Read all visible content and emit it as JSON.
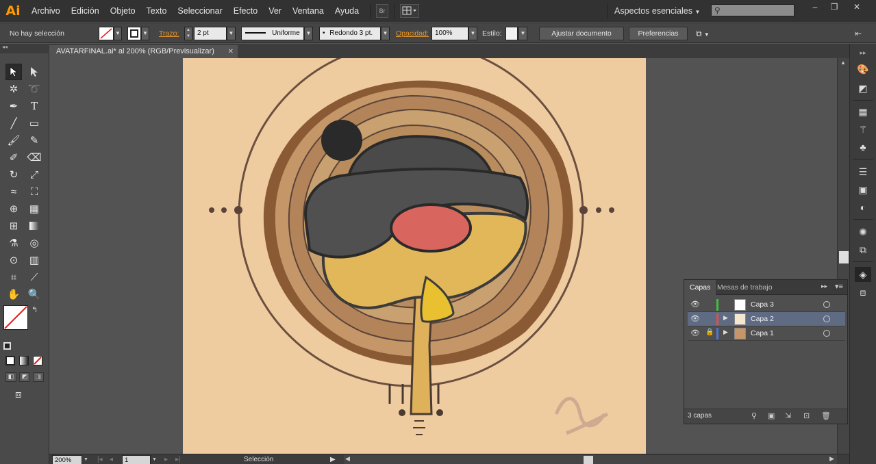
{
  "app": {
    "logo": "Ai"
  },
  "menu": [
    "Archivo",
    "Edición",
    "Objeto",
    "Texto",
    "Seleccionar",
    "Efecto",
    "Ver",
    "Ventana",
    "Ayuda"
  ],
  "menubar": {
    "bridge_label": "Br",
    "workspace": "Aspectos esenciales"
  },
  "control": {
    "selection": "No hay selección",
    "stroke_label": "Trazo:",
    "stroke_value": "2 pt",
    "profile": "Uniforme",
    "brush": "Redondo 3 pt.",
    "opacity_label": "Opacidad:",
    "opacity_value": "100%",
    "style_label": "Estilo:",
    "adjust_button": "Ajustar documento",
    "prefs_button": "Preferencias"
  },
  "document": {
    "tab_title": "AVATARFINAL.ai* al 200% (RGB/Previsualizar)"
  },
  "layers_panel": {
    "tabs": [
      "Capas",
      "Mesas de trabajo"
    ],
    "layers": [
      {
        "name": "Capa 3",
        "color": "#3fc13f",
        "locked": false,
        "selected": false,
        "expandable": false
      },
      {
        "name": "Capa 2",
        "color": "#d9534f",
        "locked": false,
        "selected": true,
        "expandable": true
      },
      {
        "name": "Capa 1",
        "color": "#4a78d6",
        "locked": true,
        "selected": false,
        "expandable": true
      }
    ],
    "count": "3 capas"
  },
  "status": {
    "zoom": "200%",
    "artboard": "1",
    "tool": "Selección"
  },
  "colors": {
    "artboard": "#efcba0",
    "accent": "#e8962b"
  }
}
